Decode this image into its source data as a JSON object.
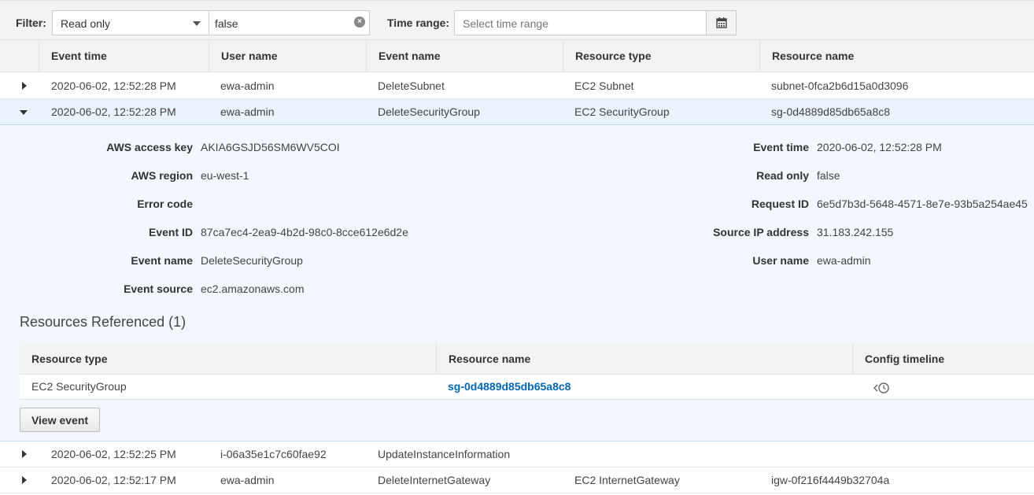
{
  "filter": {
    "label": "Filter:",
    "attribute": "Read only",
    "value": "false",
    "time_label": "Time range:",
    "time_placeholder": "Select time range"
  },
  "columns": [
    "Event time",
    "User name",
    "Event name",
    "Resource type",
    "Resource name"
  ],
  "rows": [
    {
      "time": "2020-06-02, 12:52:28 PM",
      "user": "ewa-admin",
      "event": "DeleteSubnet",
      "rtype": "EC2 Subnet",
      "rname": "subnet-0fca2b6d15a0d3096"
    },
    {
      "time": "2020-06-02, 12:52:28 PM",
      "user": "ewa-admin",
      "event": "DeleteSecurityGroup",
      "rtype": "EC2 SecurityGroup",
      "rname": "sg-0d4889d85db65a8c8"
    },
    {
      "time": "2020-06-02, 12:52:25 PM",
      "user": "i-06a35e1c7c60fae92",
      "event": "UpdateInstanceInformation",
      "rtype": "",
      "rname": ""
    },
    {
      "time": "2020-06-02, 12:52:17 PM",
      "user": "ewa-admin",
      "event": "DeleteInternetGateway",
      "rtype": "EC2 InternetGateway",
      "rname": "igw-0f216f4449b32704a"
    }
  ],
  "detail": {
    "left": [
      {
        "label": "AWS access key",
        "value": "AKIA6GSJD56SM6WV5COI"
      },
      {
        "label": "AWS region",
        "value": "eu-west-1"
      },
      {
        "label": "Error code",
        "value": ""
      },
      {
        "label": "Event ID",
        "value": "87ca7ec4-2ea9-4b2d-98c0-8cce612e6d2e"
      },
      {
        "label": "Event name",
        "value": "DeleteSecurityGroup"
      },
      {
        "label": "Event source",
        "value": "ec2.amazonaws.com"
      }
    ],
    "right": [
      {
        "label": "Event time",
        "value": "2020-06-02, 12:52:28 PM"
      },
      {
        "label": "Read only",
        "value": "false"
      },
      {
        "label": "Request ID",
        "value": "6e5d7b3d-5648-4571-8e7e-93b5a254ae45"
      },
      {
        "label": "Source IP address",
        "value": "31.183.242.155"
      },
      {
        "label": "User name",
        "value": "ewa-admin"
      }
    ],
    "resources_title": "Resources Referenced (1)",
    "resources_columns": [
      "Resource type",
      "Resource name",
      "Config timeline"
    ],
    "resource": {
      "type": "EC2 SecurityGroup",
      "name": "sg-0d4889d85db65a8c8",
      "timeline_icon": "config-timeline-icon"
    },
    "view_event_label": "View event"
  },
  "colors": {
    "link": "#0066b3",
    "selected_row": "#eaf3fb",
    "header_bg": "#f2f3f3"
  }
}
